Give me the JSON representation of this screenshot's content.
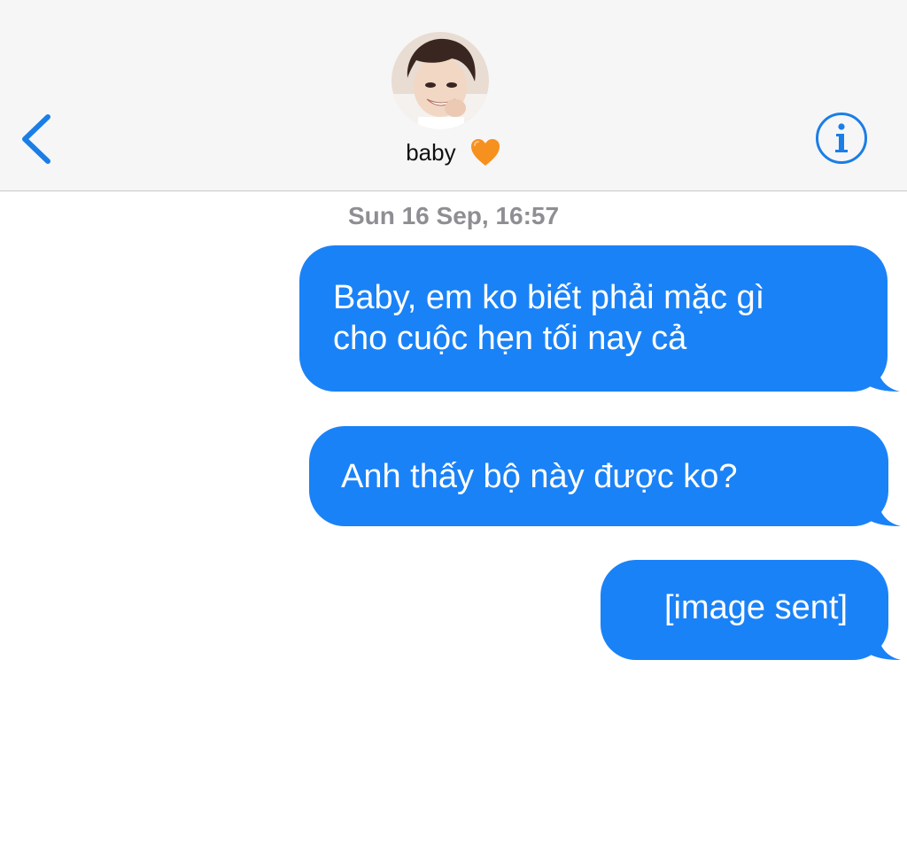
{
  "header": {
    "contact_name": "baby",
    "heart_icon": "orange-heart-icon",
    "back_icon": "chevron-left-icon",
    "info_icon": "info-icon",
    "accent_color": "#1a7ee6"
  },
  "thread": {
    "timestamp_day": "Sun 16 Sep,",
    "timestamp_time": "16:57",
    "bubble_color": "#1a82f7",
    "messages": [
      {
        "direction": "sent",
        "text": "Baby, em ko biết phải mặc gì\ncho cuộc hẹn tối nay cả"
      },
      {
        "direction": "sent",
        "text": "Anh thấy bộ này được ko?"
      },
      {
        "direction": "sent",
        "text": "[image sent]"
      }
    ]
  }
}
